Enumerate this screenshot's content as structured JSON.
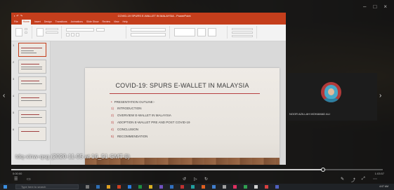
{
  "window": {
    "minimize_icon": "–",
    "maximize_icon": "□",
    "close_icon": "×"
  },
  "ppt": {
    "title_text": "COVID-19 SPURS E-WALLET IN MALAYSIA - PowerPoint",
    "tabs": [
      "File",
      "Home",
      "Insert",
      "Design",
      "Transitions",
      "Animations",
      "Slide Show",
      "Review",
      "View",
      "Help"
    ]
  },
  "slide": {
    "title": "COVID-19: SPURS E-WALLET IN MALAYSIA",
    "outline_heading": "PRESENTATION OUTLINE:-",
    "items": [
      {
        "num": "1)",
        "text": "INTRODUCTION"
      },
      {
        "num": "2)",
        "text": "OVERVIEW E-WALLET IN MALAYSIA"
      },
      {
        "num": "3)",
        "text": "ADOPTION E-WALLET PRE AND POST COVID-19"
      },
      {
        "num": "4)",
        "text": "CONCLUSION"
      },
      {
        "num": "5)",
        "text": "RECOMMENDATION"
      }
    ]
  },
  "recording_caption": "tdq-xinw-qsg (2020-11-05 at 16_51 GMT-8)",
  "participant": {
    "name": "NOOR AZILLAH MOHAMAD ALI"
  },
  "player": {
    "current_time": "0:00:00",
    "total_time": "1:03:57",
    "progress": 0.84
  },
  "nav": {
    "prev_icon": "‹",
    "next_icon": "›"
  },
  "taskbar": {
    "search_placeholder": "Type here to search",
    "clock": "4:07 AM"
  },
  "colors": {
    "ppt_accent": "#c43e1c",
    "slide_rule": "#b84040"
  }
}
